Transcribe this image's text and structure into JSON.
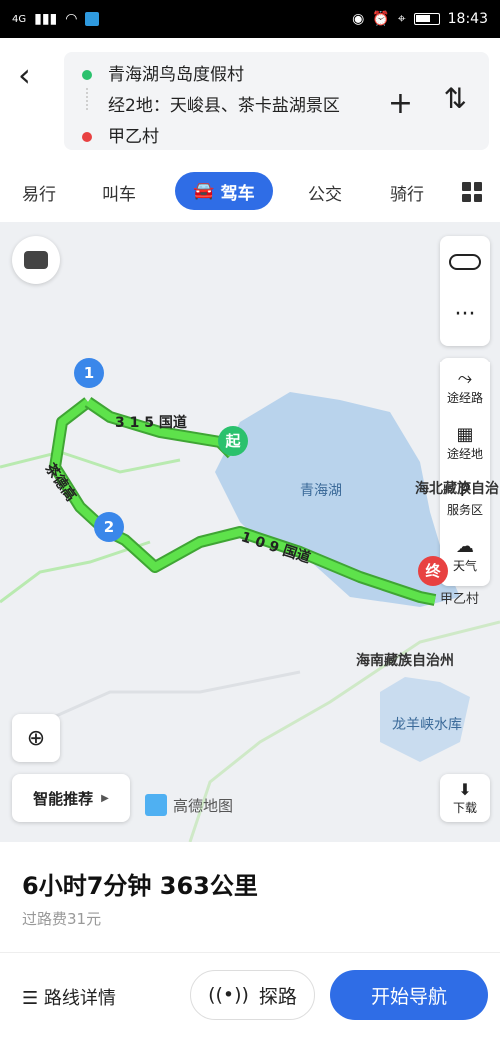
{
  "status_bar": {
    "network": "4G",
    "time": "18:43"
  },
  "route": {
    "origin": "青海湖鸟岛度假村",
    "via": "经2地：天峻县、茶卡盐湖景区",
    "destination": "甲乙村"
  },
  "tabs": [
    {
      "label": "易行"
    },
    {
      "label": "叫车"
    },
    {
      "label": "驾车",
      "active": true
    },
    {
      "label": "公交"
    },
    {
      "label": "骑行"
    }
  ],
  "map": {
    "road_labels": [
      "3 1 5 国道",
      "茶德高",
      "1 0 9 国道"
    ],
    "places": [
      "青海湖",
      "海北藏族自治",
      "海南藏族自治州",
      "龙羊峡水库",
      "甲乙村"
    ],
    "markers": {
      "start": "起",
      "end": "终",
      "waypoint1": "1",
      "waypoint2": "2"
    },
    "side_buttons": [
      {
        "label": "途经路",
        "icon": "route-icon"
      },
      {
        "label": "途经地",
        "icon": "landmark-icon"
      },
      {
        "label": "服务区",
        "icon": "gas-station-icon"
      },
      {
        "label": "天气",
        "icon": "cloud-icon"
      }
    ],
    "recommend_label": "智能推荐",
    "brand": "高德地图",
    "download_label": "下载",
    "colors": {
      "route": "#4cd137",
      "lake": "#b9d3ec",
      "accent": "#2f6de6"
    }
  },
  "summary": {
    "eta": "6小时7分钟  363公里",
    "toll": "过路费31元"
  },
  "actions": {
    "detail": "路线详情",
    "probe": "探路",
    "start": "开始导航"
  }
}
